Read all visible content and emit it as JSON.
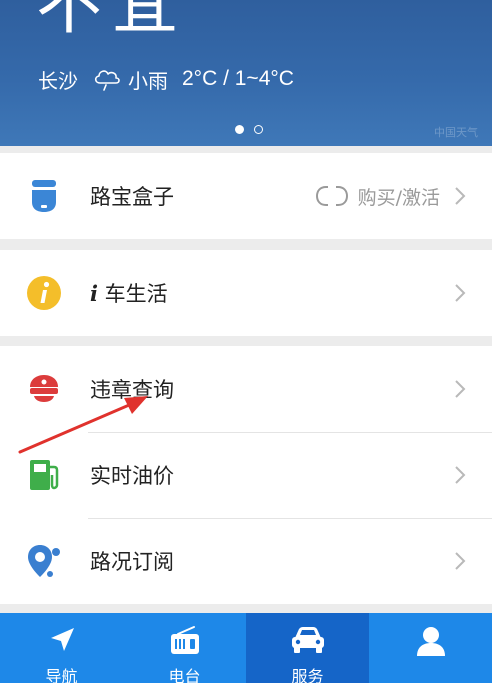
{
  "weather": {
    "headline": "不宜",
    "city": "长沙",
    "condition_icon": "cloud-rain-icon",
    "condition": "小雨",
    "temperature": "2°C / 1~4°C",
    "watermark": "中国天气",
    "pager": {
      "count": 2,
      "active": 1
    }
  },
  "menu": {
    "box": {
      "label": "路宝盒子",
      "icon": "box-device-icon",
      "action_label": "购买/激活"
    },
    "car_life": {
      "label": "车生活",
      "prefix": "i",
      "icon": "info-icon"
    },
    "violation": {
      "label": "违章查询",
      "icon": "police-cap-icon"
    },
    "fuel": {
      "label": "实时油价",
      "icon": "fuel-pump-icon"
    },
    "traffic": {
      "label": "路况订阅",
      "icon": "location-pin-icon"
    }
  },
  "tabs": [
    {
      "label": "导航",
      "icon": "navigation-arrow-icon"
    },
    {
      "label": "电台",
      "icon": "radio-icon"
    },
    {
      "label": "服务",
      "icon": "car-icon",
      "active": true
    },
    {
      "label": "",
      "icon": "user-icon"
    }
  ],
  "colors": {
    "header_blue": "#356aab",
    "tab_bar": "#1e88e8",
    "tab_active": "#1565c8",
    "annotation_red": "#e0322d",
    "box_icon_blue": "#3b86d6",
    "info_yellow": "#f4be2a",
    "police_red": "#dc3c3c",
    "fuel_green": "#3fae4a",
    "pin_blue": "#3a7fd0"
  }
}
